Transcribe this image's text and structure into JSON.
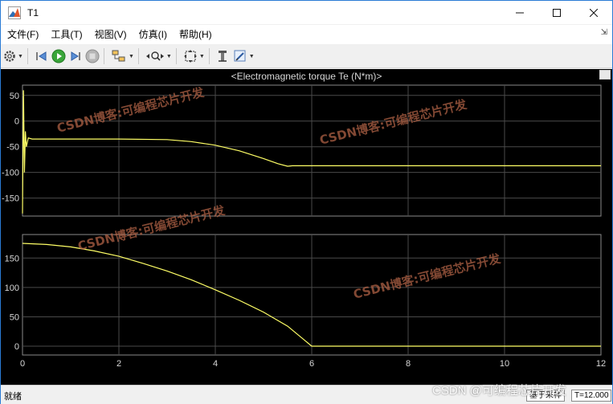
{
  "window": {
    "title": "T1"
  },
  "menu": [
    "文件(F)",
    "工具(T)",
    "视图(V)",
    "仿真(I)",
    "帮助(H)"
  ],
  "toolbar": {
    "icons": [
      "gear-icon",
      "step-back-icon",
      "run-icon",
      "step-forward-icon",
      "stop-icon",
      "signal-select-icon",
      "zoom-icon",
      "fit-icon",
      "cursor-icon",
      "highlight-icon"
    ]
  },
  "plot": {
    "title": "<Electromagnetic torque Te (N*m)>",
    "background": "#000000",
    "grid_color": "#4a4a4a",
    "line_color": "#ffff66"
  },
  "status": {
    "left": "就绪",
    "mode": "基于采样",
    "time": "T=12.000"
  },
  "watermarks": [
    "CSDN博客:可编程芯片开发",
    "CSDN @可编程芯片开发"
  ],
  "chart_data": [
    {
      "type": "line",
      "title": "<Electromagnetic torque Te (N*m)>",
      "xlim": [
        0,
        12
      ],
      "ylim": [
        -185,
        70
      ],
      "yticks": [
        50,
        0,
        -50,
        -100,
        -150
      ],
      "grid": true,
      "series": [
        {
          "x": [
            0,
            0.02,
            0.04,
            0.06,
            0.08,
            0.12,
            0.2,
            0.5,
            1,
            2,
            3,
            3.5,
            4,
            4.5,
            5,
            5.3,
            5.5,
            5.6,
            6,
            8,
            10,
            12
          ],
          "y": [
            -180,
            60,
            -100,
            -20,
            -50,
            -33,
            -35,
            -35,
            -35,
            -35,
            -36,
            -40,
            -47,
            -58,
            -73,
            -83,
            -88,
            -87,
            -87,
            -87,
            -87,
            -87
          ]
        }
      ]
    },
    {
      "type": "line",
      "xlim": [
        0,
        12
      ],
      "ylim": [
        -15,
        190
      ],
      "yticks": [
        150,
        100,
        50,
        0
      ],
      "xticks": [
        0,
        2,
        4,
        6,
        8,
        10,
        12
      ],
      "grid": true,
      "series": [
        {
          "x": [
            0,
            0.5,
            1,
            1.5,
            2,
            2.5,
            3,
            3.5,
            4,
            4.5,
            5,
            5.5,
            6,
            7,
            8,
            9,
            10,
            11,
            12
          ],
          "y": [
            175,
            173,
            169,
            162,
            153,
            141,
            128,
            113,
            96,
            78,
            58,
            34,
            0,
            0,
            0,
            0,
            0,
            0,
            0
          ]
        }
      ]
    }
  ]
}
